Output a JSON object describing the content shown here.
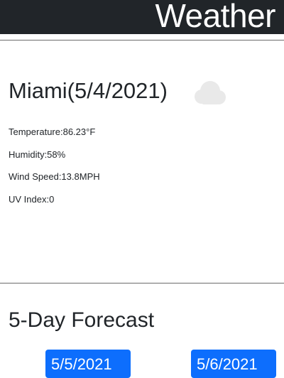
{
  "header": {
    "title": "Weather"
  },
  "current": {
    "title": "Miami(5/4/2021)",
    "icon": "cloud-icon",
    "temperature": "Temperature:86.23°F",
    "humidity": "Humidity:58%",
    "wind_speed": "Wind Speed:13.8MPH",
    "uv_index": "UV Index:0"
  },
  "forecast": {
    "title": "5-Day Forecast",
    "cards": [
      {
        "date": "5/5/2021"
      },
      {
        "date": "5/6/2021"
      }
    ]
  },
  "colors": {
    "header_bg": "#212529",
    "card_bg": "#0d6efd",
    "icon": "#e9e9e9"
  }
}
